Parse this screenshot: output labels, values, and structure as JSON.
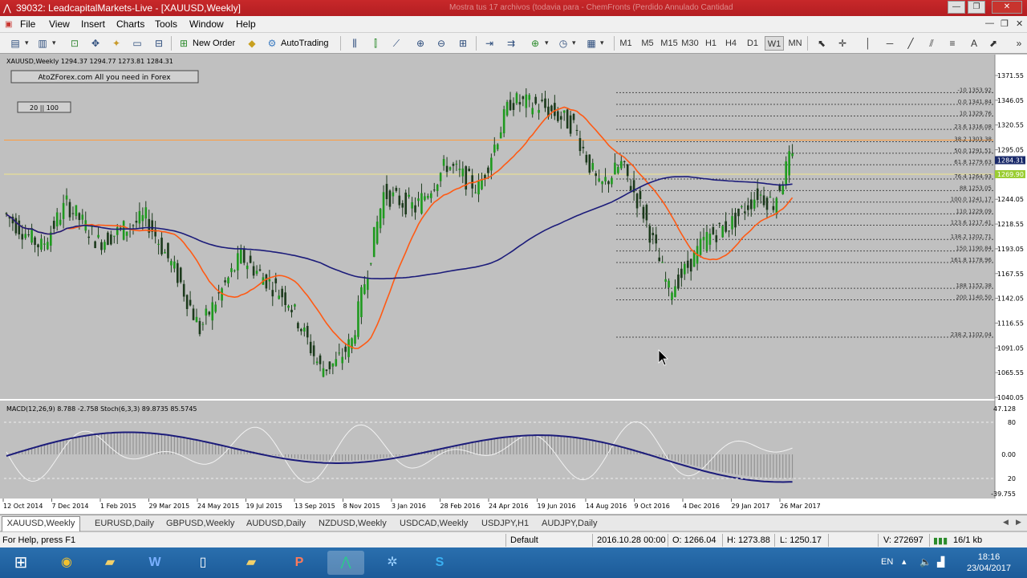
{
  "window": {
    "title": "39032: LeadcapitalMarkets-Live - [XAUUSD,Weekly]",
    "ghost_text": "Mostra tus 17 archivos (todavia para - ChemFronts (Perdido Annulado Cantidad"
  },
  "menu": [
    "File",
    "View",
    "Insert",
    "Charts",
    "Tools",
    "Window",
    "Help"
  ],
  "toolbar": {
    "new_order": "New Order",
    "autotrading": "AutoTrading",
    "timeframes": [
      "M1",
      "M5",
      "M15",
      "M30",
      "H1",
      "H4",
      "D1",
      "W1",
      "MN"
    ],
    "active_timeframe": "W1"
  },
  "chart": {
    "header": "XAUUSD,Weekly  1294.37 1294.77 1273.81 1284.31",
    "banner": "AtoZForex.com  All you need in Forex",
    "ma_label": "20 || 100",
    "indicator_header": "MACD(12,26,9) 8.788 -2.758  Stoch(6,3,3) 89.8735 85.5745",
    "current_price": "1284.31",
    "green_price": "1269.90"
  },
  "chart_data": {
    "type": "candlestick",
    "symbol": "XAUUSD",
    "timeframe": "Weekly",
    "price_axis": [
      "1371.55",
      "1346.05",
      "1320.55",
      "1295.05",
      "1269.90",
      "1244.05",
      "1218.55",
      "1193.05",
      "1167.55",
      "1142.05",
      "1116.55",
      "1091.05",
      "1065.55",
      "1040.05"
    ],
    "price_ylim": [
      1040.05,
      1371.55
    ],
    "indicator_axis": [
      "47.128",
      "80",
      "0.00",
      "20",
      "-39.755"
    ],
    "x_axis_labels": [
      "12 Oct 2014",
      "7 Dec 2014",
      "1 Feb 2015",
      "29 Mar 2015",
      "24 May 2015",
      "19 Jul 2015",
      "13 Sep 2015",
      "8 Nov 2015",
      "3 Jan 2016",
      "28 Feb 2016",
      "24 Apr 2016",
      "19 Jun 2016",
      "14 Aug 2016",
      "9 Oct 2016",
      "4 Dec 2016",
      "29 Jan 2017",
      "26 Mar 2017"
    ],
    "fibonacci_levels": [
      {
        "label": "-10 1353.92",
        "price": 1353.92
      },
      {
        "label": "0.0 1341.84",
        "price": 1341.84
      },
      {
        "label": "10 1329.76",
        "price": 1329.76
      },
      {
        "label": "23.6 1316.08",
        "price": 1316.08
      },
      {
        "label": "38.2 1303.38",
        "price": 1303.38
      },
      {
        "label": "50.0 1291.51",
        "price": 1291.51
      },
      {
        "label": "61.8 1279.63",
        "price": 1279.63
      },
      {
        "label": "76.4 1264.93",
        "price": 1264.93
      },
      {
        "label": "88 1253.05",
        "price": 1253.05
      },
      {
        "label": "100.0 1241.17",
        "price": 1241.17
      },
      {
        "label": "110 1229.09",
        "price": 1229.09
      },
      {
        "label": "123.6 1217.41",
        "price": 1217.41
      },
      {
        "label": "138.2 1202.71",
        "price": 1202.71
      },
      {
        "label": "150 1190.84",
        "price": 1190.84
      },
      {
        "label": "161.8 1178.96",
        "price": 1178.96
      },
      {
        "label": "188 1152.38",
        "price": 1152.38
      },
      {
        "label": "200 1140.50",
        "price": 1140.5
      },
      {
        "label": "238.2 1102.04",
        "price": 1102.04
      }
    ],
    "colors": {
      "background": "#c0c0c0",
      "bull": "#1f9a1f",
      "bear": "#1c3a1c",
      "ma20": "#ff5a14",
      "ma100": "#1c1c7a",
      "macd_line": "#1c1c7a",
      "stoch": "#f2f2f2",
      "fib": "#4a4a4a",
      "orange_hline": "#ff9b3b",
      "yellow_hline": "#f0e68c"
    }
  },
  "tabs": [
    "XAUUSD,Weekly",
    "EURUSD,Daily",
    "GBPUSD,Weekly",
    "AUDUSD,Daily",
    "NZDUSD,Weekly",
    "USDCAD,Weekly",
    "USDJPY,H1",
    "AUDJPY,Daily"
  ],
  "active_tab": "XAUUSD,Weekly",
  "status": {
    "help": "For Help, press F1",
    "profile": "Default",
    "date": "2016.10.28 00:00",
    "open": "O: 1266.04",
    "high": "H: 1273.88",
    "low": "L: 1250.17",
    "volume": "V: 272697",
    "traffic": "16/1 kb"
  },
  "taskbar": {
    "lang": "EN",
    "time": "18:16",
    "date": "23/04/2017"
  }
}
